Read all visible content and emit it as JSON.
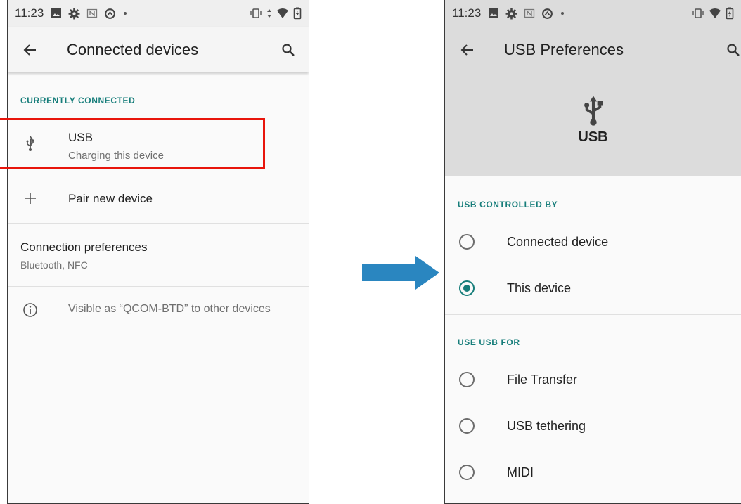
{
  "left": {
    "status_time": "11:23",
    "title": "Connected devices",
    "section_currently_connected": "CURRENTLY CONNECTED",
    "usb_title": "USB",
    "usb_subtitle": "Charging this device",
    "pair_label": "Pair new device",
    "conn_pref_title": "Connection preferences",
    "conn_pref_subtitle": "Bluetooth, NFC",
    "visible_text": "Visible as “QCOM-BTD” to other devices"
  },
  "right": {
    "status_time": "11:23",
    "title": "USB Preferences",
    "hero_label": "USB",
    "section_controlled_by": "USB CONTROLLED BY",
    "controlled_options": [
      {
        "label": "Connected device",
        "selected": false
      },
      {
        "label": "This device",
        "selected": true
      }
    ],
    "section_use_for": "USE USB FOR",
    "use_options": [
      {
        "label": "File Transfer",
        "selected": false
      },
      {
        "label": "USB tethering",
        "selected": false
      },
      {
        "label": "MIDI",
        "selected": false
      }
    ]
  },
  "colors": {
    "accent": "#167d7a",
    "highlight": "#e8150c",
    "arrow": "#2a86c0"
  },
  "icons": [
    "back-arrow-icon",
    "search-icon",
    "usb-icon",
    "plus-icon",
    "info-icon",
    "image-icon",
    "gear-icon",
    "nfc-icon",
    "data-saver-icon",
    "dot-icon",
    "vibrate-icon",
    "wifi-icon",
    "battery-icon",
    "right-arrow-icon"
  ]
}
